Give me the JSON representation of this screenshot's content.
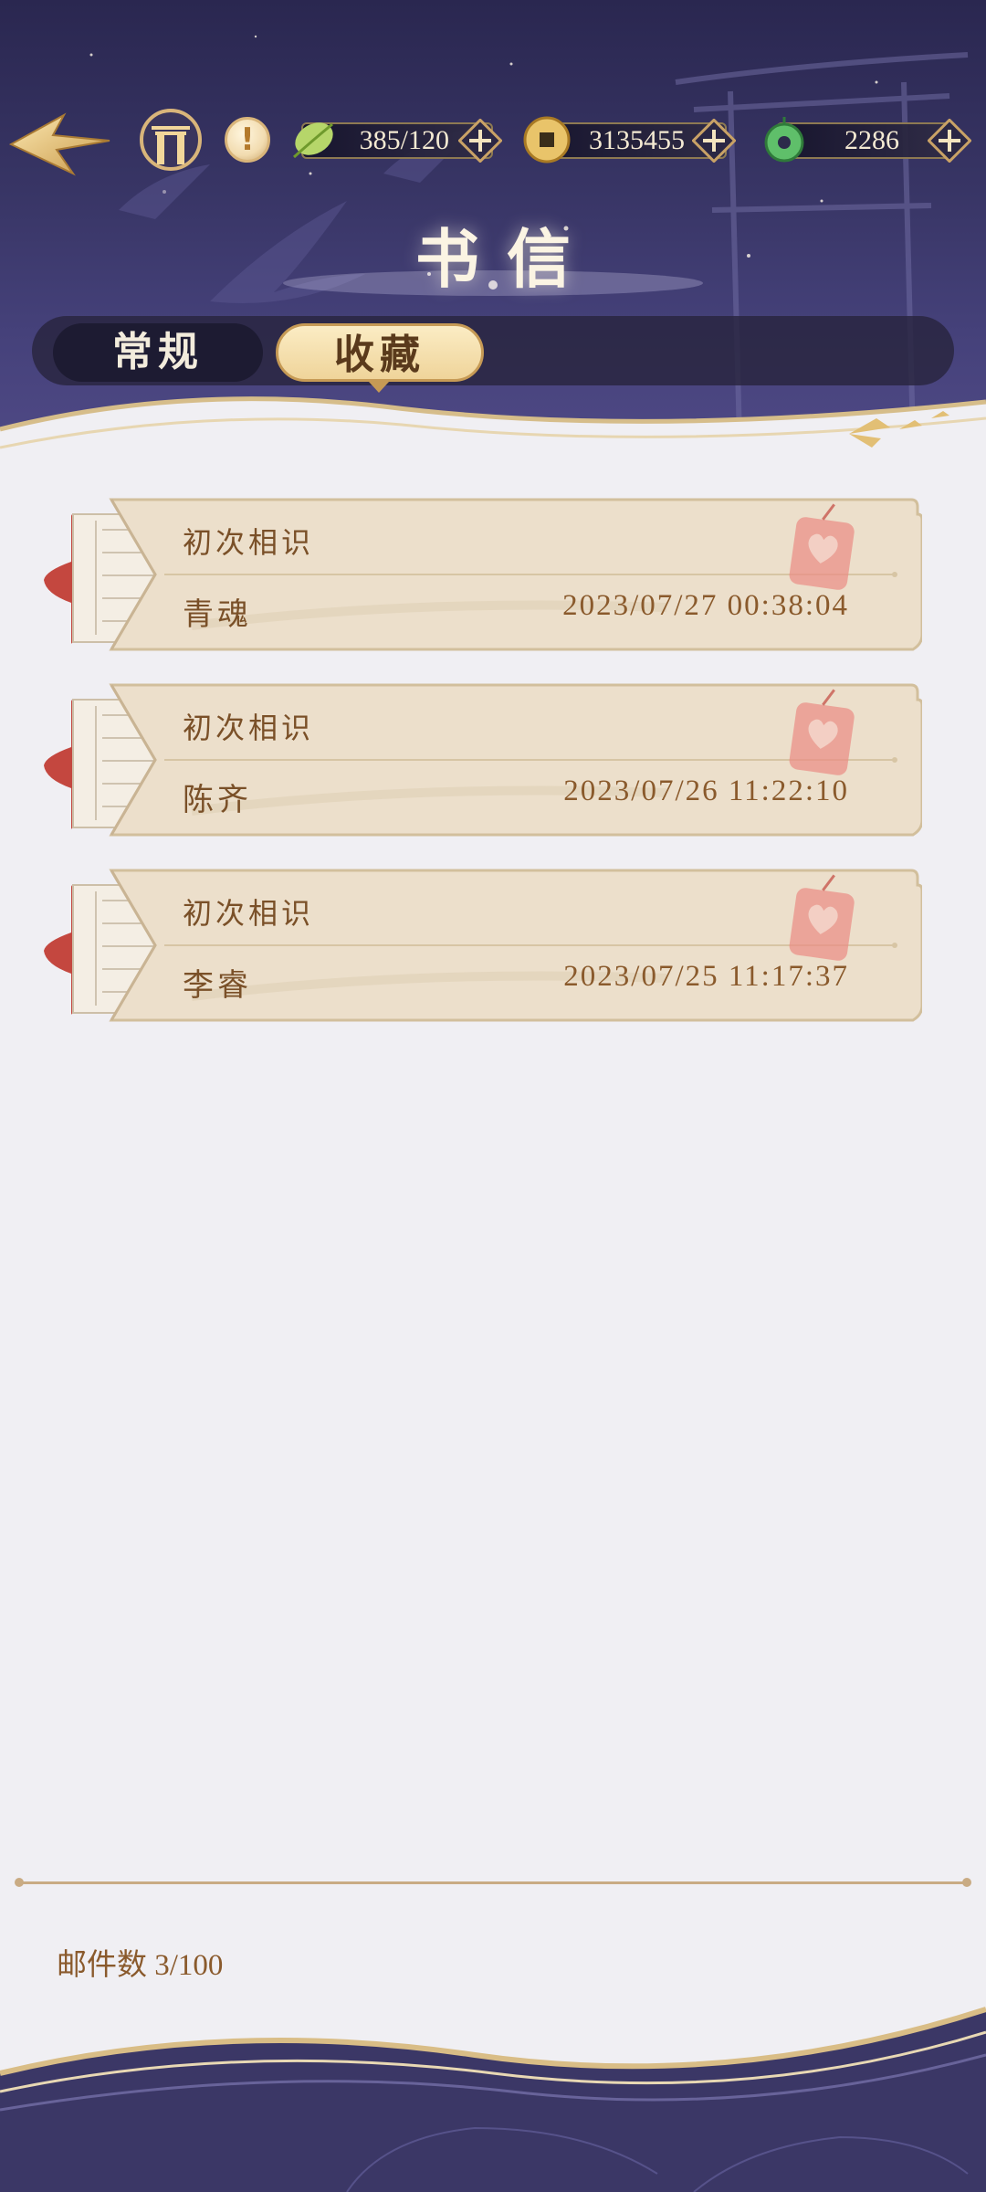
{
  "header": {
    "title": "书信",
    "resources": [
      {
        "icon": "green-leaf-icon",
        "value": "385/120"
      },
      {
        "icon": "copper-coin-icon",
        "value": "3135455"
      },
      {
        "icon": "jade-pendant-icon",
        "value": "2286"
      }
    ]
  },
  "tabs": [
    {
      "label": "常规",
      "selected": false
    },
    {
      "label": "收藏",
      "selected": true
    }
  ],
  "letters": [
    {
      "subject": "初次相识",
      "sender": "青魂",
      "time": "2023/07/27 00:38:04"
    },
    {
      "subject": "初次相识",
      "sender": "陈齐",
      "time": "2023/07/26 11:22:10"
    },
    {
      "subject": "初次相识",
      "sender": "李睿",
      "time": "2023/07/25 11:17:37"
    }
  ],
  "footer": {
    "mail_count": "邮件数 3/100"
  },
  "colors": {
    "header_bg": "#383565",
    "gold": "#d9b57a",
    "letter_paper": "#ecdfcb",
    "seal_red": "#c4473f",
    "text_brown": "#7a5028"
  }
}
